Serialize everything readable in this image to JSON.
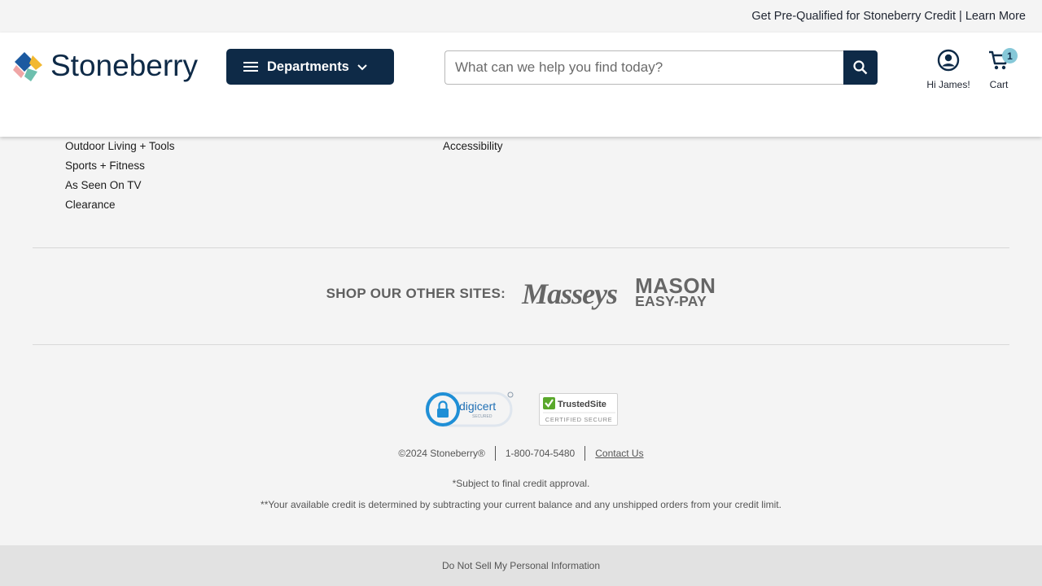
{
  "topbar": {
    "promo_text": "Get Pre-Qualified for Stoneberry Credit | Learn More"
  },
  "header": {
    "logo_text": "Stoneberry",
    "departments_label": "Departments",
    "search": {
      "placeholder": "What can we help you find today?",
      "value": ""
    },
    "account_label": "Hi James!",
    "cart_label": "Cart",
    "cart_count": "1"
  },
  "footer": {
    "left_links": [
      "Outdoor Living + Tools",
      "Sports + Fitness",
      "As Seen On TV",
      "Clearance"
    ],
    "right_links": [
      "Accessibility"
    ],
    "other_sites_label": "SHOP OUR OTHER SITES:",
    "other_sites": [
      "Masseys",
      "MASON",
      "EASY-PAY"
    ],
    "digicert": {
      "name": "digicert",
      "sub": "SECURED"
    },
    "trustedsite": {
      "name": "TrustedSite",
      "sub": "CERTIFIED SECURE"
    },
    "copyright": "©2024 Stoneberry®",
    "phone": "1-800-704-5480",
    "contact": "Contact Us",
    "note1": "*Subject to final credit approval.",
    "note2": "**Your available credit is determined by subtracting your current balance and any unshipped orders from your credit limit.",
    "do_not_sell": "Do Not Sell My Personal Information"
  },
  "colors": {
    "navy": "#0e2a47",
    "badge": "#86c8d8",
    "page_bg": "#f4f4f4"
  },
  "icons": [
    "menu-icon",
    "chevron-down-icon",
    "search-icon",
    "account-icon",
    "cart-icon",
    "lock-icon",
    "check-icon"
  ]
}
